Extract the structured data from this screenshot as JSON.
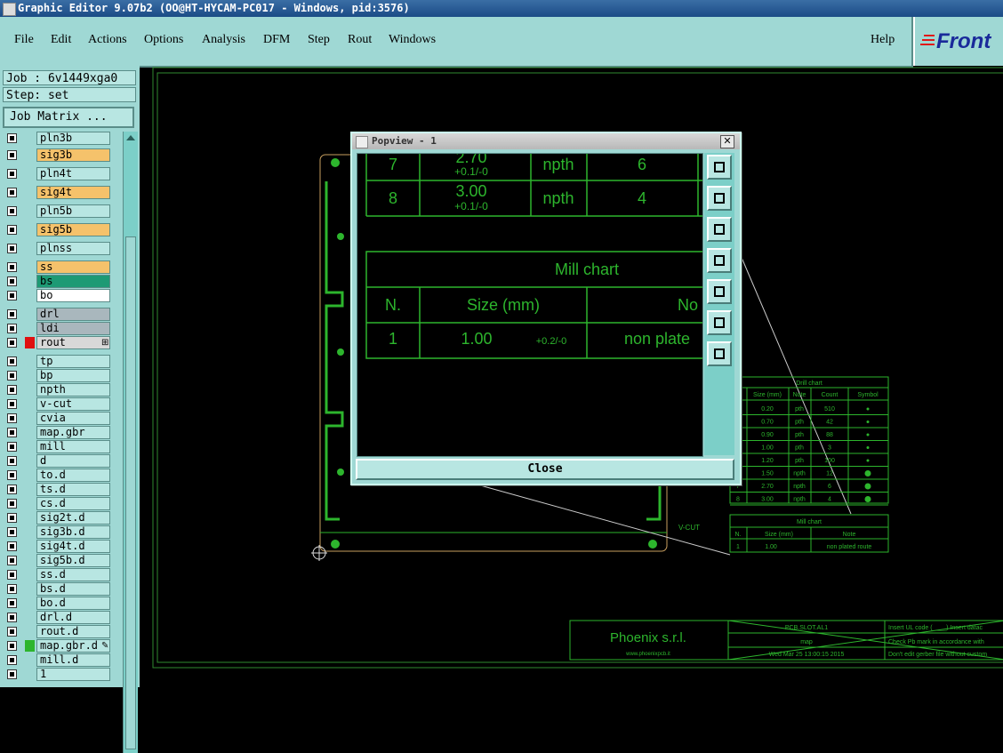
{
  "window": {
    "title": "Graphic Editor 9.07b2 (OO@HT-HYCAM-PC017 - Windows, pid:3576)"
  },
  "menu": {
    "items": [
      "File",
      "Edit",
      "Actions",
      "Options",
      "Analysis",
      "DFM",
      "Step",
      "Rout",
      "Windows"
    ],
    "help": "Help",
    "logo": "Front"
  },
  "job": {
    "job_label": "Job : 6v1449xga0",
    "step_label": "Step: set",
    "matrix_button": "Job Matrix ..."
  },
  "layers": [
    {
      "name": "pln3b",
      "bg": "#b8e6e2"
    },
    {
      "name": "sig3b",
      "bg": "#f5c26b"
    },
    {
      "name": "pln4t",
      "bg": "#b8e6e2"
    },
    {
      "name": "sig4t",
      "bg": "#f5c26b"
    },
    {
      "name": "pln5b",
      "bg": "#b8e6e2"
    },
    {
      "name": "sig5b",
      "bg": "#f5c26b"
    },
    {
      "name": "plnss",
      "bg": "#b8e6e2"
    },
    {
      "name": "ss",
      "bg": "#f5c26b"
    },
    {
      "name": "bs",
      "bg": "#1d9a74"
    },
    {
      "name": "bo",
      "bg": "#ffffff"
    },
    {
      "name": "drl",
      "bg": "#a9b7bd"
    },
    {
      "name": "ldi",
      "bg": "#a9b7bd"
    },
    {
      "name": "rout",
      "bg": "#d8d8d8",
      "color": "#e01010",
      "mark": "⊞"
    },
    {
      "name": "tp",
      "bg": "#b8e6e2"
    },
    {
      "name": "bp",
      "bg": "#b8e6e2"
    },
    {
      "name": "npth",
      "bg": "#b8e6e2"
    },
    {
      "name": "v-cut",
      "bg": "#b8e6e2"
    },
    {
      "name": "cvia",
      "bg": "#b8e6e2"
    },
    {
      "name": "map.gbr",
      "bg": "#b8e6e2"
    },
    {
      "name": "mill",
      "bg": "#b8e6e2"
    },
    {
      "name": "d",
      "bg": "#b8e6e2"
    },
    {
      "name": "to.d",
      "bg": "#b8e6e2"
    },
    {
      "name": "ts.d",
      "bg": "#b8e6e2"
    },
    {
      "name": "cs.d",
      "bg": "#b8e6e2"
    },
    {
      "name": "sig2t.d",
      "bg": "#b8e6e2"
    },
    {
      "name": "sig3b.d",
      "bg": "#b8e6e2"
    },
    {
      "name": "sig4t.d",
      "bg": "#b8e6e2"
    },
    {
      "name": "sig5b.d",
      "bg": "#b8e6e2"
    },
    {
      "name": "ss.d",
      "bg": "#b8e6e2"
    },
    {
      "name": "bs.d",
      "bg": "#b8e6e2"
    },
    {
      "name": "bo.d",
      "bg": "#b8e6e2"
    },
    {
      "name": "drl.d",
      "bg": "#b8e6e2"
    },
    {
      "name": "rout.d",
      "bg": "#b8e6e2"
    },
    {
      "name": "map.gbr.d",
      "bg": "#b8e6e2",
      "color": "#2db52d",
      "mark": "✎"
    },
    {
      "name": "mill.d",
      "bg": "#b8e6e2"
    },
    {
      "name": "1",
      "bg": "#b8e6e2"
    }
  ],
  "popup": {
    "title": "Popview - 1",
    "close_label": "Close",
    "drill_rows": [
      {
        "n": "7",
        "size": "2.70",
        "tol": "+0.1/-0",
        "note": "npth",
        "count": "6"
      },
      {
        "n": "8",
        "size": "3.00",
        "tol": "+0.1/-0",
        "note": "npth",
        "count": "4"
      }
    ],
    "mill_title": "Mill chart",
    "mill_headers": [
      "N.",
      "Size (mm)",
      "No"
    ],
    "mill_row": {
      "n": "1",
      "size": "1.00",
      "tol": "+0.2/-0",
      "note": "non plate"
    }
  },
  "board": {
    "drill_chart": {
      "title": "Drill chart",
      "headers": [
        "N.",
        "Size (mm)",
        "Note",
        "Count",
        "Symbol"
      ],
      "rows": [
        [
          "1",
          "0.20",
          "pth",
          "510"
        ],
        [
          "2",
          "0.70",
          "pth",
          "42"
        ],
        [
          "3",
          "0.90",
          "pth",
          "88"
        ],
        [
          "4",
          "1.00",
          "pth",
          "3"
        ],
        [
          "5",
          "1.20",
          "pth",
          "100"
        ],
        [
          "6",
          "1.50",
          "npth",
          "12"
        ],
        [
          "7",
          "2.70",
          "npth",
          "6"
        ],
        [
          "8",
          "3.00",
          "npth",
          "4"
        ]
      ]
    },
    "mill_chart": {
      "title": "Mill chart",
      "headers": [
        "N.",
        "Size (mm)",
        "Note"
      ],
      "row": [
        "1",
        "1.00",
        "non plated route"
      ]
    },
    "vcut_label": "V-CUT",
    "title_block": {
      "company": "Phoenix s.r.l.",
      "website": "www.phoenixpcb.it",
      "part": "PCB.SLOT.AL1",
      "layer": "map",
      "date": "Wed Mar 25 13:00:15 2015",
      "notes": [
        "Insert UL code (____)  Insert datac",
        "Check Pb mark in accordance with",
        "Don't edit gerber file without custom"
      ]
    }
  },
  "colors": {
    "panel": "#9fd8d4",
    "accent": "#2db52d",
    "canvas": "#000000"
  }
}
